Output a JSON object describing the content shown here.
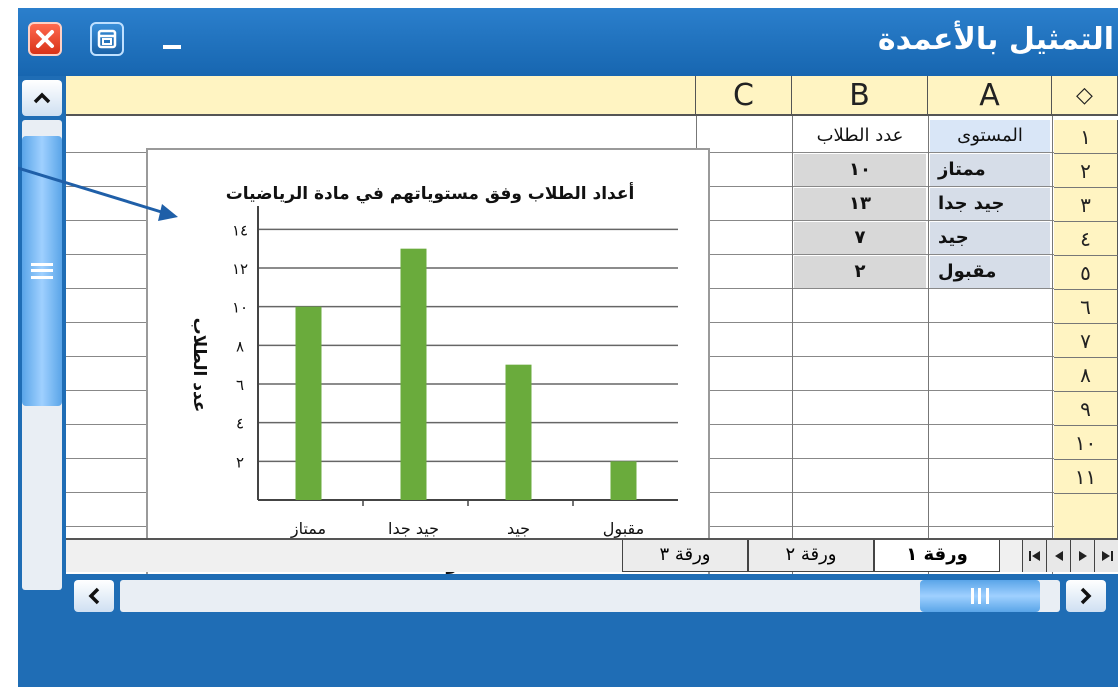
{
  "window": {
    "title": "التمثيل بالأعمدة"
  },
  "grid": {
    "corner_symbol": "◇",
    "columns": [
      "A",
      "B",
      "C"
    ],
    "row_numbers": [
      "١",
      "٢",
      "٣",
      "٤",
      "٥",
      "٦",
      "٧",
      "٨",
      "٩",
      "١٠",
      "١١"
    ],
    "header_row": {
      "a": "المستوى",
      "b": "عدد الطلاب"
    },
    "data_rows": [
      {
        "a": "ممتاز",
        "b": "١٠"
      },
      {
        "a": "جيد جدا",
        "b": "١٣"
      },
      {
        "a": "جيد",
        "b": "٧"
      },
      {
        "a": "مقبول",
        "b": "٢"
      }
    ]
  },
  "sheet_tabs": [
    "ورقة ١",
    "ورقة ٢",
    "ورقة ٣"
  ],
  "chart_data": {
    "type": "bar",
    "title": "أعداد الطلاب وفق مستوياتهم في مادة الرياضيات",
    "xlabel": "المستوى",
    "ylabel": "عدد الطلاب",
    "categories": [
      "ممتاز",
      "جيد جدا",
      "جيد",
      "مقبول"
    ],
    "values": [
      10,
      13,
      7,
      2
    ],
    "ylim": [
      0,
      15
    ],
    "yticks": [
      2,
      4,
      6,
      8,
      10,
      12,
      14
    ],
    "ytick_labels": [
      "٢",
      "٤",
      "٦",
      "٨",
      "١٠",
      "١٢",
      "١٤"
    ],
    "bar_color": "#6aab3c",
    "grid": true
  },
  "colors": {
    "frame": "#1f6db5",
    "header_bg": "#fff4c2",
    "bar": "#6aab3c"
  }
}
